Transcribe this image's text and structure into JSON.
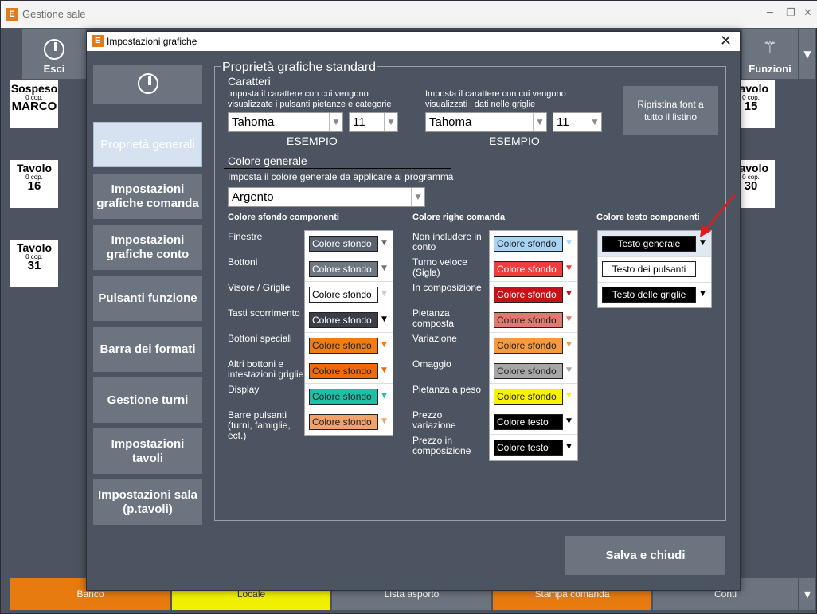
{
  "main_window": {
    "title": "Gestione sale",
    "logo_letter": "E",
    "toolbar": {
      "esci_label": "Esci",
      "funzioni_label": "Funzioni"
    },
    "tables": [
      {
        "name": "Sospeso",
        "cop": "0 cop.",
        "num": "MARCO"
      },
      {
        "name": "Tavolo",
        "cop": "0 cop.",
        "num": "16"
      },
      {
        "name": "Tavolo",
        "cop": "0 cop.",
        "num": "31"
      },
      {
        "name": "Tavolo",
        "cop": "0 cop.",
        "num": "15"
      },
      {
        "name": "Tavolo",
        "cop": "0 cop.",
        "num": "30"
      }
    ],
    "bottom_bar": [
      {
        "label": "Banco",
        "color": "#e87b0f"
      },
      {
        "label": "Locale",
        "color": "#f0f000"
      },
      {
        "label": "Lista asporto",
        "color": "#6c7480"
      },
      {
        "label": "Stampa comanda",
        "color": "#e87b0f"
      },
      {
        "label": "Conti",
        "color": "#6c7480"
      }
    ]
  },
  "dialog": {
    "title": "Impostazioni grafiche",
    "logo_letter": "E",
    "close_glyph": "✕",
    "nav": [
      {
        "label": "Proprietà generali",
        "active": true
      },
      {
        "label": "Impostazioni grafiche comanda"
      },
      {
        "label": "Impostazioni grafiche conto"
      },
      {
        "label": "Pulsanti funzione"
      },
      {
        "label": "Barra dei formati"
      },
      {
        "label": "Gestione turni"
      },
      {
        "label": "Impostazioni tavoli"
      },
      {
        "label": "Impostazioni sala (p.tavoli)"
      }
    ],
    "group_title": "Proprietà grafiche standard",
    "caratteri": {
      "title": "Caratteri",
      "buttons_desc": "Imposta il carattere con cui vengono visualizzate i pulsanti pietanze e categorie",
      "grid_desc": "Imposta il carattere con cui vengono visualizzati i dati nelle griglie",
      "buttons_font": "Tahoma",
      "buttons_size": "11",
      "grid_font": "Tahoma",
      "grid_size": "11",
      "example_label": "ESEMPIO"
    },
    "reset_label": "Ripristina font a tutto il listino",
    "colore_generale": {
      "title": "Colore generale",
      "desc": "Imposta il colore generale da applicare al programma",
      "value": "Argento"
    },
    "sfondo_componenti": {
      "title": "Colore sfondo componenti",
      "rows": [
        {
          "label": "Finestre",
          "swatch": "Colore sfondo",
          "bg": "#5a6270",
          "fg": "#ffffff",
          "arrow": "#5a6270"
        },
        {
          "label": "Bottoni",
          "swatch": "Colore sfondo",
          "bg": "#6e7682",
          "fg": "#ffffff",
          "arrow": "#6e7682"
        },
        {
          "label": "Visore / Griglie",
          "swatch": "Colore sfondo",
          "bg": "#ffffff",
          "fg": "#000000",
          "arrow": "#ffffff"
        },
        {
          "label": "Tasti scorrimento",
          "swatch": "Colore sfondo",
          "bg": "#3a3f47",
          "fg": "#ffffff",
          "arrow": "#000000"
        },
        {
          "label": "Bottoni speciali",
          "swatch": "Colore sfondo",
          "bg": "#f07d14",
          "fg": "#222222",
          "arrow": "#f07d14"
        },
        {
          "label": "Altri bottoni e intestazioni griglie",
          "swatch": "Colore sfondo",
          "bg": "#f06a0a",
          "fg": "#222222",
          "arrow": "#f06a0a"
        },
        {
          "label": "Display",
          "swatch": "Colore sfondo",
          "bg": "#1dbfa8",
          "fg": "#222222",
          "arrow": "#1dbfa8"
        },
        {
          "label": "Barre pulsanti (turni, famiglie, ect.)",
          "swatch": "Colore sfondo",
          "bg": "#f2a268",
          "fg": "#222222",
          "arrow": "#f2a268"
        }
      ]
    },
    "righe_comanda": {
      "title": "Colore righe comanda",
      "rows": [
        {
          "label": "Non includere in conto",
          "swatch": "Colore sfondo",
          "bg": "#a7d4f3",
          "fg": "#222222",
          "arrow": "#a7d4f3"
        },
        {
          "label": "Turno veloce (Sigla)",
          "swatch": "Colore sfondo",
          "bg": "#f03c3c",
          "fg": "#ffffff",
          "arrow": "#f03c3c"
        },
        {
          "label": "In composizione",
          "swatch": "Colore sfondo",
          "bg": "#c8101a",
          "fg": "#ffffff",
          "arrow": "#c8101a"
        },
        {
          "label": "Pietanza composta",
          "swatch": "Colore sfondo",
          "bg": "#e07a70",
          "fg": "#222222",
          "arrow": "#e07a70"
        },
        {
          "label": "Variazione",
          "swatch": "Colore sfondo",
          "bg": "#f69a40",
          "fg": "#222222",
          "arrow": "#f69a40"
        },
        {
          "label": "Omaggio",
          "swatch": "Colore sfondo",
          "bg": "#a6a6a6",
          "fg": "#222222",
          "arrow": "#a6a6a6"
        },
        {
          "label": "Pietanza a peso",
          "swatch": "Colore sfondo",
          "bg": "#f7f200",
          "fg": "#222222",
          "arrow": "#f7f200"
        },
        {
          "label": "Prezzo variazione",
          "swatch": "Colore testo",
          "bg": "#000000",
          "fg": "#ffffff",
          "arrow": "#000000"
        },
        {
          "label": "Prezzo in composizione",
          "swatch": "Colore testo",
          "bg": "#000000",
          "fg": "#ffffff",
          "arrow": "#000000"
        }
      ]
    },
    "testo_componenti": {
      "title": "Colore testo componenti",
      "rows": [
        {
          "swatch": "Testo generale",
          "bg": "#000000",
          "fg": "#ffffff",
          "arrow": "#000000"
        },
        {
          "swatch": "Testo dei pulsanti",
          "bg": "#ffffff",
          "fg": "#000000",
          "arrow": ""
        },
        {
          "swatch": "Testo delle griglie",
          "bg": "#000000",
          "fg": "#ffffff",
          "arrow": "#000000"
        }
      ]
    },
    "save_label": "Salva e chiudi"
  }
}
